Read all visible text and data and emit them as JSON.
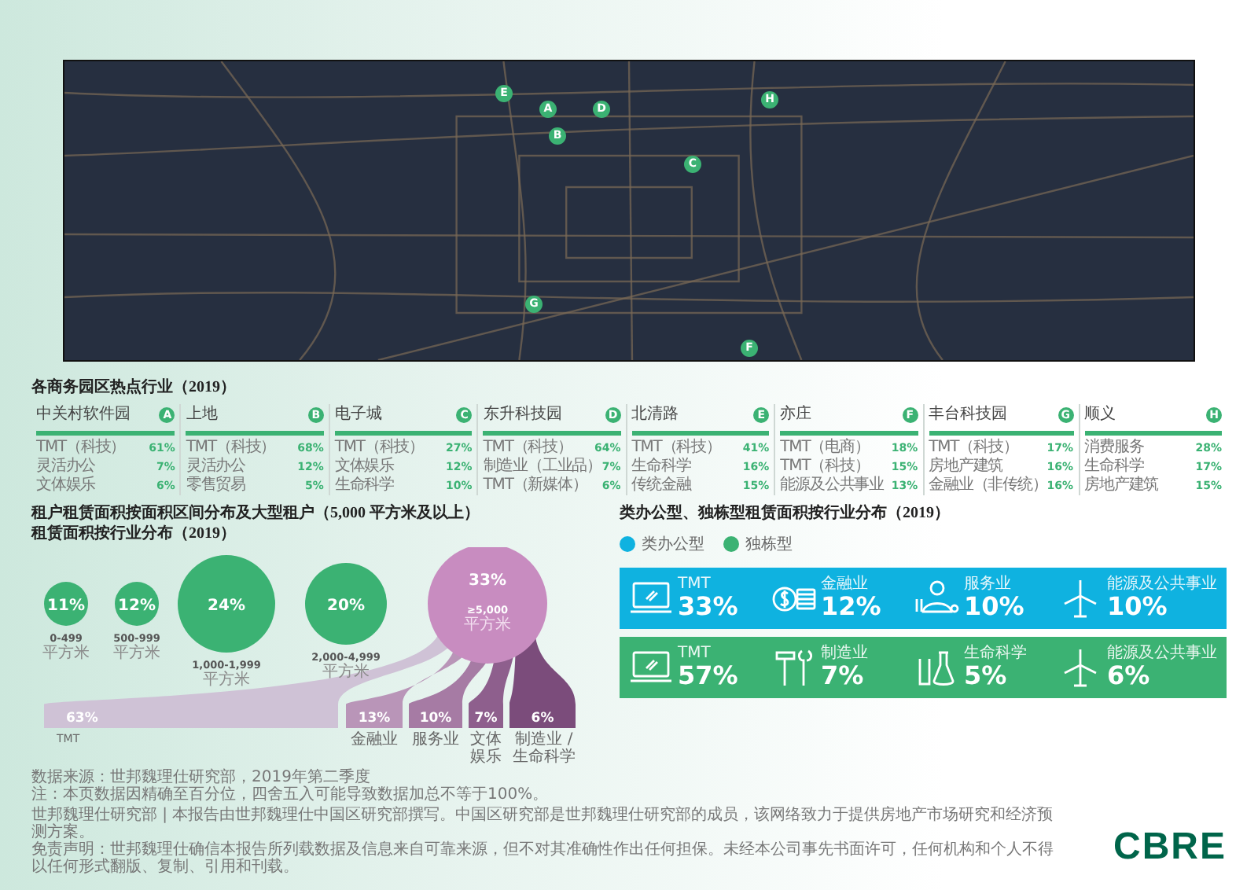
{
  "map": {
    "markers": [
      {
        "label": "E"
      },
      {
        "label": "A"
      },
      {
        "label": "B"
      },
      {
        "label": "D"
      },
      {
        "label": "H"
      },
      {
        "label": "C"
      },
      {
        "label": "G"
      },
      {
        "label": "F"
      }
    ]
  },
  "districts": {
    "title": "各商务园区热点行业（2019）",
    "items": [
      {
        "name": "中关村软件园",
        "marker": "A",
        "industries": [
          {
            "label": "TMT（科技）",
            "share": "61%"
          },
          {
            "label": "灵活办公",
            "share": "7%"
          },
          {
            "label": "文体娱乐",
            "share": "6%"
          }
        ]
      },
      {
        "name": "上地",
        "marker": "B",
        "industries": [
          {
            "label": "TMT（科技）",
            "share": "68%"
          },
          {
            "label": "灵活办公",
            "share": "12%"
          },
          {
            "label": "零售贸易",
            "share": "5%"
          }
        ]
      },
      {
        "name": "电子城",
        "marker": "C",
        "industries": [
          {
            "label": "TMT（科技）",
            "share": "27%"
          },
          {
            "label": "文体娱乐",
            "share": "12%"
          },
          {
            "label": "生命科学",
            "share": "10%"
          }
        ]
      },
      {
        "name": "东升科技园",
        "marker": "D",
        "industries": [
          {
            "label": "TMT（科技）",
            "share": "64%"
          },
          {
            "label": "制造业（工业品）",
            "share": "7%"
          },
          {
            "label": "TMT（新媒体）",
            "share": "6%"
          }
        ]
      },
      {
        "name": "北清路",
        "marker": "E",
        "industries": [
          {
            "label": "TMT（科技）",
            "share": "41%"
          },
          {
            "label": "生命科学",
            "share": "16%"
          },
          {
            "label": "传统金融",
            "share": "15%"
          }
        ]
      },
      {
        "name": "亦庄",
        "marker": "F",
        "industries": [
          {
            "label": "TMT（电商）",
            "share": "18%"
          },
          {
            "label": "TMT（科技）",
            "share": "15%"
          },
          {
            "label": "能源及公共事业",
            "share": "13%"
          }
        ]
      },
      {
        "name": "丰台科技园",
        "marker": "G",
        "industries": [
          {
            "label": "TMT（科技）",
            "share": "17%"
          },
          {
            "label": "房地产建筑",
            "share": "16%"
          },
          {
            "label": "金融业（非传统）",
            "share": "16%"
          }
        ]
      },
      {
        "name": "顺义",
        "marker": "H",
        "industries": [
          {
            "label": "消费服务",
            "share": "28%"
          },
          {
            "label": "生命科学",
            "share": "17%"
          },
          {
            "label": "房地产建筑",
            "share": "15%"
          }
        ]
      }
    ]
  },
  "size_distribution": {
    "title_lines": [
      "租户租赁面积按面积区间分布及大型租户（5,000 平方米及以上）",
      "租赁面积按行业分布（2019）"
    ],
    "bands": [
      {
        "share": "11%",
        "range": "0-499",
        "unit": "平方米"
      },
      {
        "share": "12%",
        "range": "500-999",
        "unit": "平方米"
      },
      {
        "share": "24%",
        "range": "1,000-1,999",
        "unit": "平方米"
      },
      {
        "share": "20%",
        "range": "2,000-4,999",
        "unit": "平方米"
      },
      {
        "share": "33%",
        "range": "≥5,000",
        "unit": "平方米"
      }
    ],
    "large_industries": [
      {
        "share": "63%",
        "label": "TMT"
      },
      {
        "share": "13%",
        "label": "金融业"
      },
      {
        "share": "10%",
        "label": "服务业"
      },
      {
        "share": "7%",
        "label": "文体娱乐"
      },
      {
        "share": "6%",
        "label": "制造业 / 生命科学"
      }
    ]
  },
  "type_distribution": {
    "title": "类办公型、独栋型租赁面积按行业分布（2019）",
    "legend": [
      {
        "label": "类办公型",
        "color": "#0fb2e0"
      },
      {
        "label": "独栋型",
        "color": "#3bb273"
      }
    ],
    "rows": [
      {
        "color": "#0fb2e0",
        "items": [
          {
            "kind": "laptop",
            "label": "TMT",
            "share": "33%"
          },
          {
            "kind": "coins",
            "label": "金融业",
            "share": "12%"
          },
          {
            "kind": "service",
            "label": "服务业",
            "share": "10%"
          },
          {
            "kind": "turbine",
            "label": "能源及公共事业",
            "share": "10%"
          }
        ]
      },
      {
        "color": "#3bb273",
        "items": [
          {
            "kind": "laptop",
            "label": "TMT",
            "share": "57%"
          },
          {
            "kind": "tools",
            "label": "制造业",
            "share": "7%"
          },
          {
            "kind": "flask",
            "label": "生命科学",
            "share": "5%"
          },
          {
            "kind": "turbine",
            "label": "能源及公共事业",
            "share": "6%"
          }
        ]
      }
    ]
  },
  "footer": {
    "notes": [
      "数据来源：世邦魏理仕研究部，2019年第二季度",
      "注：本页数据因精确至百分位，四舍五入可能导致数据加总不等于100%。",
      "世邦魏理仕研究部 | 本报告由世邦魏理仕中国区研究部撰写。中国区研究部是世邦魏理仕研究部的成员，该网络致力于提供房地产市场研究和经济预测方案。",
      "免责声明：世邦魏理仕确信本报告所列载数据及信息来自可靠来源，但不对其准确性作出任何担保。未经本公司事先书面许可，任何机构和个人不得以任何形式翻版、复制、引用和刊载。"
    ],
    "logo": "CBRE"
  }
}
